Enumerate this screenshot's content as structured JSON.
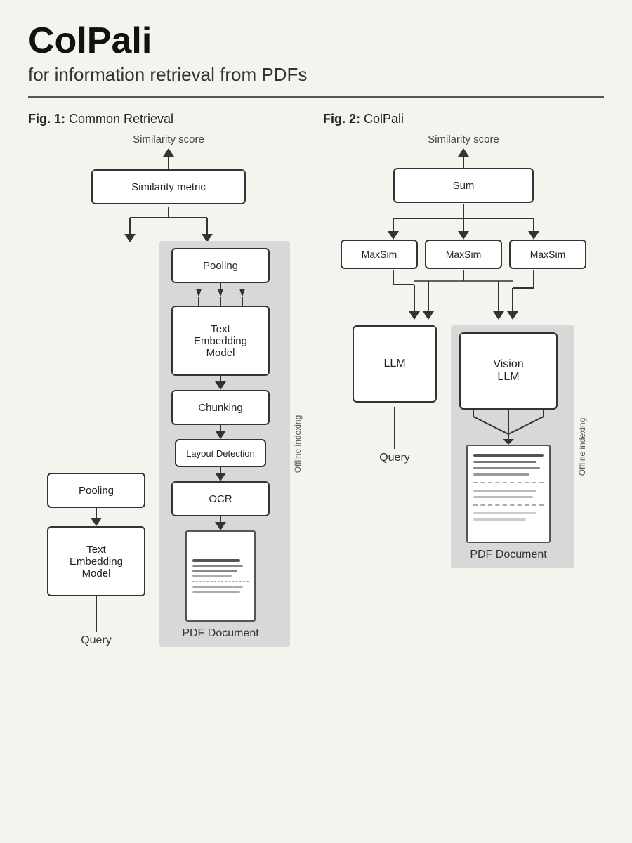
{
  "title": "ColPali",
  "subtitle": "for information retrieval from PDFs",
  "fig1": {
    "label_bold": "Fig. 1:",
    "label_rest": " Common Retrieval",
    "similarity_score_top": "Similarity score",
    "similarity_metric_box": "Similarity metric",
    "pooling_left": "Pooling",
    "pooling_right": "Pooling",
    "text_embedding_left": "Text\nEmbedding\nModel",
    "text_embedding_right": "Text\nEmbedding\nModel",
    "chunking": "Chunking",
    "layout_detection": "Layout Detection",
    "ocr": "OCR",
    "pdf_document": "PDF Document",
    "query": "Query",
    "offline_indexing": "Offline indexing"
  },
  "fig2": {
    "label_bold": "Fig. 2:",
    "label_rest": " ColPali",
    "similarity_score_top": "Similarity score",
    "sum_box": "Sum",
    "maxsim1": "MaxSim",
    "maxsim2": "MaxSim",
    "maxsim3": "MaxSim",
    "llm_box": "LLM",
    "vision_llm_box": "Vision\nLLM",
    "pdf_document": "PDF Document",
    "query": "Query",
    "offline_indexing": "Offline indexing"
  }
}
